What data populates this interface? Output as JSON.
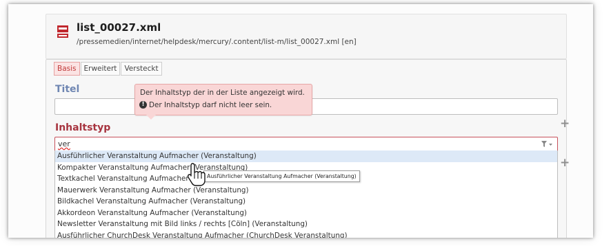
{
  "header": {
    "title": "list_00027.xml",
    "path": "/pressemedien/internet/helpdesk/mercury/.content/list-m/list_00027.xml [en]",
    "icon": "file-xml-icon",
    "icon_color": "#c0272d"
  },
  "tabs": [
    {
      "label": "Basis",
      "active": true
    },
    {
      "label": "Erweitert",
      "active": false
    },
    {
      "label": "Versteckt",
      "active": false
    }
  ],
  "fields": {
    "titel_label": "Titel",
    "inhaltstyp_label": "Inhaltstyp",
    "inhaltstyp_value": "ver"
  },
  "error_tooltip": {
    "help_text": "Der Inhaltstyp der in der Liste angezeigt wird.",
    "error_text": "Der Inhaltstyp darf nicht leer sein."
  },
  "dropdown": {
    "options": [
      "Ausführlicher Veranstaltung Aufmacher (Veranstaltung)",
      "Kompakter Veranstaltung Aufmacher (Veranstaltung)",
      "Textkachel Veranstaltung Aufmacher (Veranstaltung)",
      "Mauerwerk Veranstaltung Aufmacher (Veranstaltung)",
      "Bildkachel Veranstaltung Aufmacher (Veranstaltung)",
      "Akkordeon Veranstaltung Aufmacher (Veranstaltung)",
      "Newsletter Veranstaltung mit Bild links / rechts [Cöln] (Veranstaltung)",
      "Ausführlicher ChurchDesk Veranstaltung Aufmacher (ChurchDesk Veranstaltung)"
    ],
    "hovered_index": 0
  },
  "hover_tooltip": "Ausführlicher Veranstaltung Aufmacher (Veranstaltung)",
  "colors": {
    "accent_error": "#a7343f",
    "label_blue": "#6f86b2",
    "hover_row": "#dde9f7"
  }
}
